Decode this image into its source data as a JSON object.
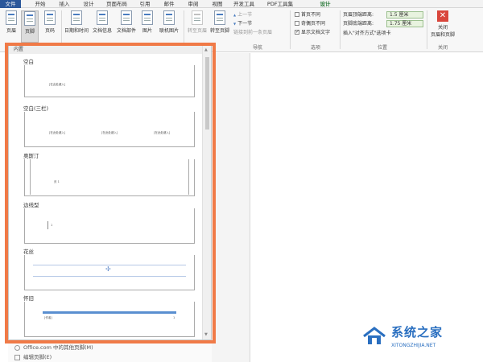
{
  "ribbon_tabs": [
    "文件",
    "开始",
    "插入",
    "设计",
    "页面布局",
    "引用",
    "邮件",
    "审阅",
    "视图",
    "开发工具",
    "PDF工具集",
    "设计"
  ],
  "buttons": {
    "header": "页眉",
    "footer": "页脚",
    "page_number": "页码",
    "date_time": "日期和时间",
    "doc_info": "文档信息",
    "doc_parts": "文档部件",
    "picture": "图片",
    "online_picture": "联机图片",
    "goto_header": "转至页眉",
    "goto_footer": "转至页脚",
    "prev_section": "上一节",
    "next_section": "下一节",
    "link_previous": "链接到前一条页眉",
    "close": "关闭",
    "close_sub": "页眉和页脚"
  },
  "options": {
    "different_first": "首页不同",
    "different_odd_even": "奇偶页不同",
    "show_doc_text": "显示文档文字"
  },
  "position": {
    "header_from_top_label": "页眉顶端距离:",
    "header_from_top_value": "1.5 厘米",
    "footer_from_bottom_label": "页脚底端距离:",
    "footer_from_bottom_value": "1.75 厘米",
    "insert_align_tab": "插入\"对齐方式\"选项卡"
  },
  "groups": {
    "navigation": "导航",
    "options": "选项",
    "position": "位置",
    "close": "关闭"
  },
  "gallery": {
    "section_header": "内置",
    "entries": [
      {
        "title": "空白"
      },
      {
        "title": "空白(三栏)"
      },
      {
        "title": "奥斯汀"
      },
      {
        "title": "边线型"
      },
      {
        "title": "花丝"
      },
      {
        "title": "怀旧"
      }
    ]
  },
  "menu_below": {
    "more_office": "Office.com 中的其他页脚(M)",
    "edit_footer": "编辑页脚(E)"
  },
  "watermark": {
    "name": "系统之家",
    "url": "XITONGZHIJIA.NET"
  },
  "colors": {
    "highlight": "#f07a47",
    "file_tab": "#2b579a",
    "design_tab": "#2b7a3a",
    "close": "#d9463c"
  }
}
